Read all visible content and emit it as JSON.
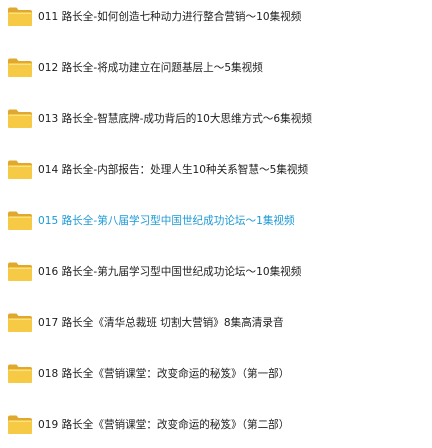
{
  "folders": {
    "items": [
      {
        "label": "011 路长全-如何创造七种动力进行整合营销～10集视频",
        "selected": false
      },
      {
        "label": "012 路长全-将成功建立在问题基层上～5集视频",
        "selected": false
      },
      {
        "label": "013 路长全-智慧底牌-成功背后的10大思维方式～6集视频",
        "selected": false
      },
      {
        "label": "014 路长全-内部报告：处理人生10种关系智慧～5集视频",
        "selected": false
      },
      {
        "label": "015 路长全-第八届学习型中国世纪成功论坛～1集视频",
        "selected": true
      },
      {
        "label": "016 路长全-第九届学习型中国世纪成功论坛～10集视频",
        "selected": false
      },
      {
        "label": "017 路长全《清华总裁班 切割大营销》8集高清录音",
        "selected": false
      },
      {
        "label": "018 路长全《营销课堂：改变命运的秘笈》（第一部）",
        "selected": false
      },
      {
        "label": "019 路长全《营销课堂：改变命运的秘笈》（第二部）",
        "selected": false
      }
    ]
  },
  "colors": {
    "text": "#1e1e1e",
    "selected_text": "#1a9ad6",
    "folder_back": "#e0a82e",
    "folder_front": "#f7ca45"
  }
}
